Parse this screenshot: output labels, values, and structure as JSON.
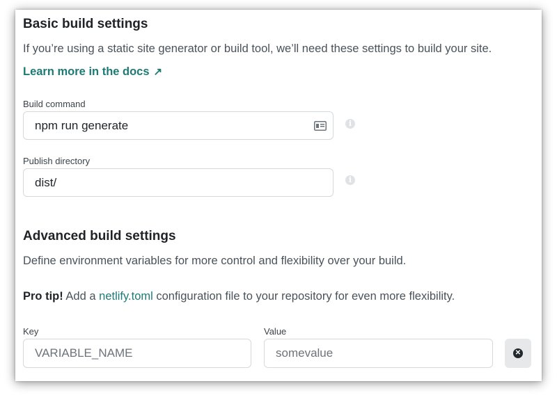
{
  "basic": {
    "title": "Basic build settings",
    "description": "If you’re using a static site generator or build tool, we’ll need these settings to build your site.",
    "docs_link": "Learn more in the docs",
    "docs_arrow": "↗",
    "build_command": {
      "label": "Build command",
      "value": "npm run generate"
    },
    "publish_directory": {
      "label": "Publish directory",
      "value": "dist/"
    }
  },
  "advanced": {
    "title": "Advanced build settings",
    "description": "Define environment variables for more control and flexibility over your build.",
    "pro_tip_prefix": "Pro tip!",
    "pro_tip_text_1": " Add a ",
    "pro_tip_link": "netlify.toml",
    "pro_tip_text_2": " configuration file to your repository for even more flexibility.",
    "key": {
      "label": "Key",
      "placeholder": "VARIABLE_NAME"
    },
    "value": {
      "label": "Value",
      "placeholder": "somevalue"
    }
  },
  "icons": {
    "info": "info-icon",
    "card": "card-icon",
    "remove": "remove-icon"
  },
  "colors": {
    "accent": "#1d7a75",
    "text": "#1f2327",
    "muted": "#4a5259"
  }
}
